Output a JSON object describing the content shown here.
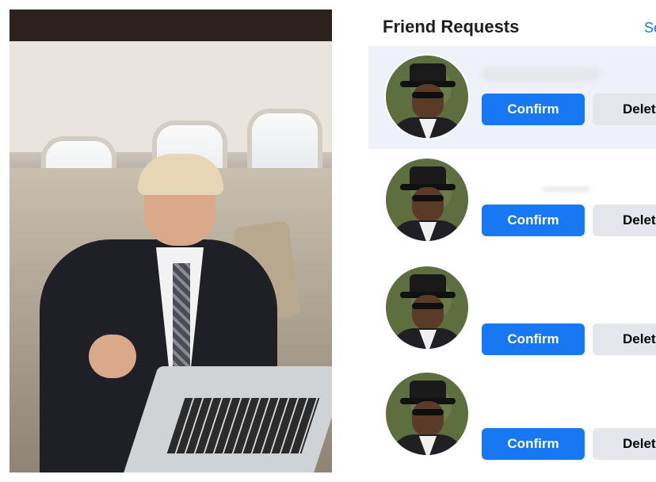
{
  "panel": {
    "title": "Friend Requests",
    "see_all": "Se"
  },
  "requests": [
    {
      "confirm_label": "Confirm",
      "delete_label": "Delet"
    },
    {
      "confirm_label": "Confirm",
      "delete_label": "Delet"
    },
    {
      "confirm_label": "Confirm",
      "delete_label": "Delet"
    },
    {
      "confirm_label": "Confirm",
      "delete_label": "Delet"
    }
  ],
  "colors": {
    "confirm_blue": "#1877f2",
    "delete_gray": "#e4e6eb",
    "title_text": "#1c1e21"
  }
}
